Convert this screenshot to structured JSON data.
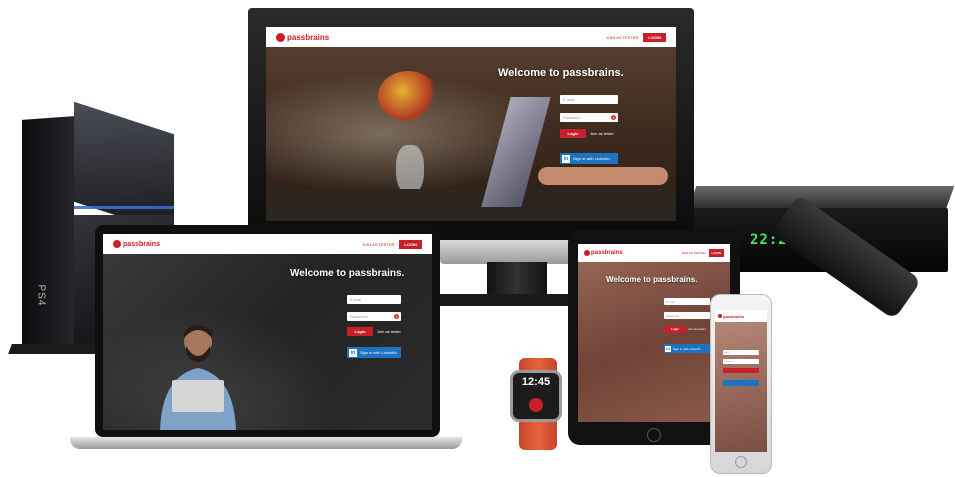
{
  "brand": {
    "name": "passbrains",
    "color": "#c8202a"
  },
  "header": {
    "join_label": "JOIN AS TESTER",
    "login_label": "LOGIN"
  },
  "form": {
    "welcome": "Welcome to passbrains.",
    "email_placeholder": "E-mail",
    "password_placeholder": "Password",
    "login_button": "Login",
    "join_text": "Join as tester",
    "linkedin_button": "Sign in with LinkedIn",
    "linkedin_icon": "in"
  },
  "devices": {
    "ps4_label": "PS4",
    "stb_clock": "22:22",
    "watch_time": "12:45"
  },
  "colors": {
    "accent": "#c8202a",
    "linkedin": "#1b73c2",
    "clock_green": "#4de36a"
  }
}
